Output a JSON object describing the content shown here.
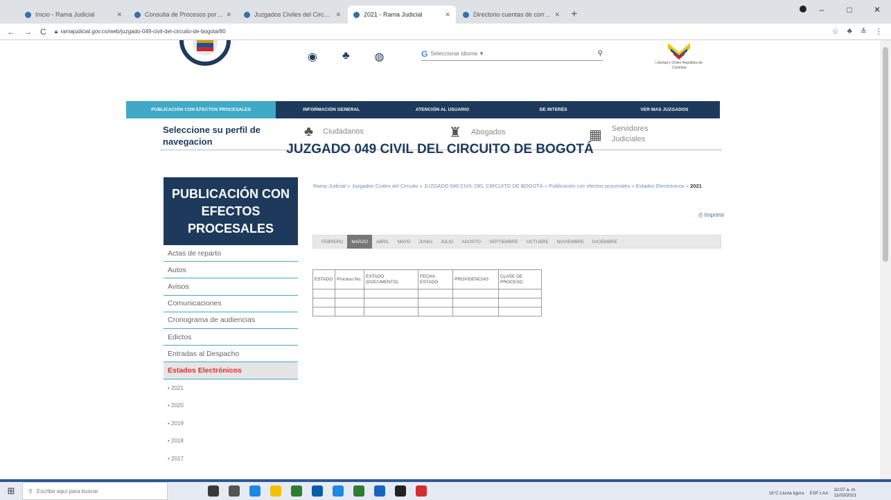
{
  "browser": {
    "tabs": [
      {
        "label": "Inicio - Rama Judicial",
        "active": false
      },
      {
        "label": "Consulta de Procesos por Núm",
        "active": false
      },
      {
        "label": "Juzgados Civiles del Circuito",
        "active": false
      },
      {
        "label": "2021 - Rama Judicial",
        "active": true
      },
      {
        "label": "Directorio cuentas de correo el",
        "active": false
      }
    ],
    "new_tab": "+",
    "window_controls": {
      "minimize": "–",
      "maximize": "□",
      "close": "✕"
    },
    "url": "ramajudicial.gov.co/web/juzgado-049-civil-del-circuito-de-bogota/80",
    "nav": {
      "back": "←",
      "forward": "→",
      "reload": "C"
    },
    "addr_icons": [
      "☆",
      "♣",
      "≛",
      "⋮"
    ]
  },
  "header": {
    "util_icons": [
      "◉",
      "♣",
      "◍"
    ],
    "translate": {
      "g": "G",
      "placeholder": "Seleccionar idioma ▼",
      "search_icon": "⚲"
    },
    "flag_caption": "Libertad y Orden República de Colombia"
  },
  "main_nav": [
    "PUBLICACIÓN CON EFECTOS PROCESALES",
    "INFORMACIÓN GENERAL",
    "ATENCIÓN AL USUARIO",
    "DE INTERÉS",
    "VER MAS JUZGADOS"
  ],
  "profile_bar": {
    "label": "Seleccione su perfil de navegacion",
    "items": [
      {
        "label": "Ciudadanos",
        "icon": "people-icon",
        "glyph": "♣"
      },
      {
        "label": "Abogados",
        "icon": "lawyer-icon",
        "glyph": "♜"
      },
      {
        "label": "Servidores Judiciales",
        "icon": "building-icon",
        "glyph": "▦"
      }
    ]
  },
  "court_title": "JUZGADO 049 CIVIL DEL CIRCUITO DE BOGOTÁ",
  "breadcrumb": {
    "path": "Rama Judicial » Juzgados Civiles del Circuito » JUZGADO 049 CIVIL DEL CIRCUITO DE BOGOTÁ » Publicación con efectos procesales » Estados Electrónicos »",
    "current": "2021"
  },
  "print_link": "Imprimir",
  "sidebar": {
    "header": "PUBLICACIÓN CON EFECTOS PROCESALES",
    "items": [
      "Actas de reparto",
      "Autos",
      "Avisos",
      "Comunicaciones",
      "Cronograma de audiencias",
      "Edictos",
      "Entradas al Despacho",
      "Estados Electrónicos"
    ],
    "active_index": 7,
    "years": [
      "• 2021",
      "• 2020",
      "• 2019",
      "• 2018",
      "• 2017"
    ]
  },
  "months": {
    "items": [
      "FEBRERO",
      "MARZO",
      "ABRIL",
      "MAYO",
      "JUNIO",
      "JULIO",
      "AGOSTO",
      "SEPTIEMBRE",
      "OCTUBRE",
      "NOVIEMBRE",
      "DICIEMBRE"
    ],
    "active": "MARZO"
  },
  "estados_table": {
    "columns": [
      "ESTADO",
      "Proceso No.",
      "ESTADO (DOCUMENTO)",
      "FECHA ESTADO",
      "PROVIDENCIAS",
      "CLASE DE PROCESO"
    ],
    "empty_rows": 3
  },
  "taskbar": {
    "start": "⊞",
    "search_placeholder": "Escribe aquí para buscar",
    "apps": [
      "#3a3a3a",
      "#555",
      "#1e88e5",
      "#f2c200",
      "#2e7d32",
      "#0b5cab",
      "#1e88e5",
      "#2e7d32",
      "#1565c0",
      "#222",
      "#d32f2f"
    ],
    "tray_text": "16°C Lluvia ligera",
    "lang": "ESP LAA",
    "time": "10:07 a. m.",
    "date": "11/03/2021"
  }
}
